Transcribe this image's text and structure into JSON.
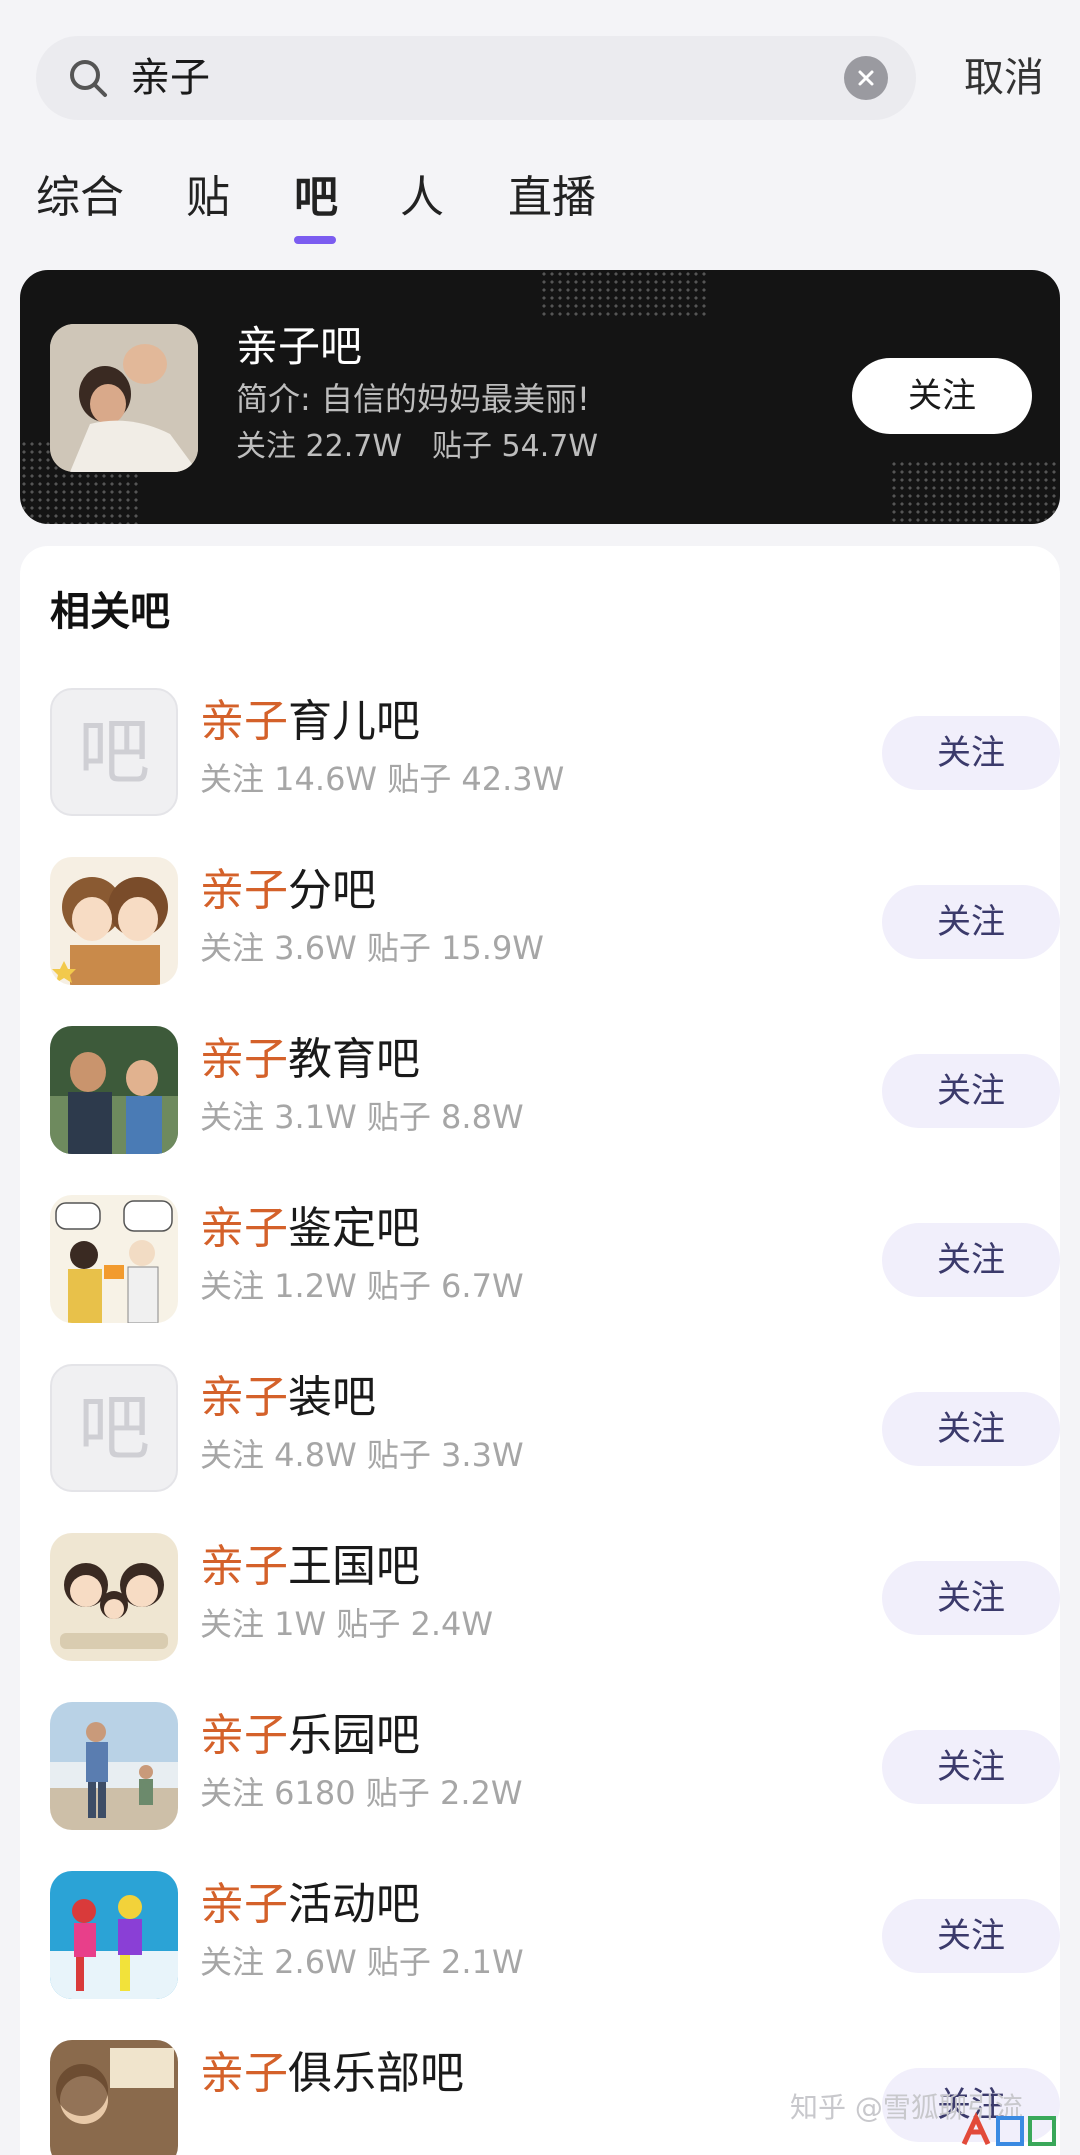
{
  "search": {
    "query": "亲子",
    "cancel_label": "取消"
  },
  "tabs": [
    {
      "label": "综合"
    },
    {
      "label": "贴"
    },
    {
      "label": "吧"
    },
    {
      "label": "人"
    },
    {
      "label": "直播"
    }
  ],
  "active_tab": "吧",
  "featured": {
    "title": "亲子吧",
    "description": "简介: 自信的妈妈最美丽!",
    "followers": "关注 22.7W",
    "posts": "贴子 54.7W",
    "follow_label": "关注"
  },
  "related": {
    "title": "相关吧",
    "highlight": "亲子",
    "items": [
      {
        "name_rest": "育儿吧",
        "stats": "关注 14.6W 贴子 42.3W",
        "follow_label": "关注",
        "thumb": "placeholder",
        "placeholder_char": "吧"
      },
      {
        "name_rest": "分吧",
        "stats": "关注 3.6W 贴子 15.9W",
        "follow_label": "关注",
        "thumb": "anime-boys-image"
      },
      {
        "name_rest": "教育吧",
        "stats": "关注 3.1W 贴子 8.8W",
        "follow_label": "关注",
        "thumb": "father-son-photo"
      },
      {
        "name_rest": "鉴定吧",
        "stats": "关注 1.2W 贴子 6.7W",
        "follow_label": "关注",
        "thumb": "comic-image"
      },
      {
        "name_rest": "装吧",
        "stats": "关注 4.8W 贴子 3.3W",
        "follow_label": "关注",
        "thumb": "placeholder",
        "placeholder_char": "吧"
      },
      {
        "name_rest": "王国吧",
        "stats": "关注 1W 贴子 2.4W",
        "follow_label": "关注",
        "thumb": "cartoon-family-image"
      },
      {
        "name_rest": "乐园吧",
        "stats": "关注 6180 贴子 2.2W",
        "follow_label": "关注",
        "thumb": "beach-photo"
      },
      {
        "name_rest": "活动吧",
        "stats": "关注 2.6W 贴子 2.1W",
        "follow_label": "关注",
        "thumb": "kids-colorful-photo"
      },
      {
        "name_rest": "俱乐部吧",
        "stats": "",
        "follow_label": "关注",
        "thumb": "mom-kid-photo"
      }
    ]
  },
  "watermark": "知乎 @雪狐聊引流",
  "colors": {
    "accent": "#7b5cf0",
    "highlight": "#d4612a",
    "follow_bg": "#f1effb"
  }
}
